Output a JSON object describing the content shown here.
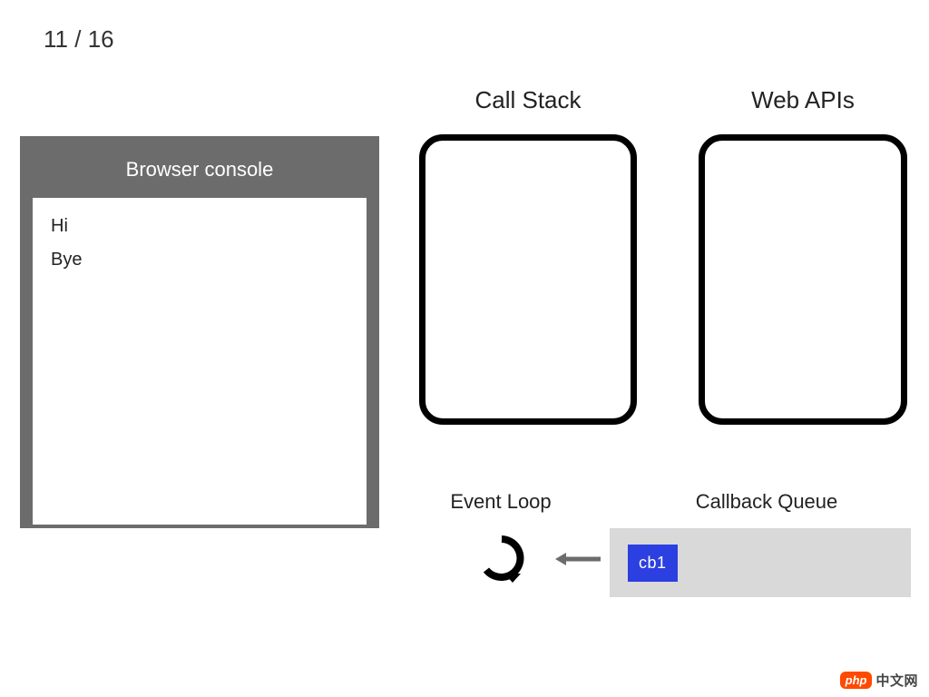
{
  "page": {
    "current": 11,
    "total": 16
  },
  "console": {
    "title": "Browser console",
    "lines": [
      "Hi",
      "Bye"
    ]
  },
  "labels": {
    "call_stack": "Call Stack",
    "web_apis": "Web APIs",
    "event_loop": "Event Loop",
    "callback_queue": "Callback Queue"
  },
  "call_stack": {
    "items": []
  },
  "web_apis": {
    "items": []
  },
  "callback_queue": {
    "items": [
      "cb1"
    ]
  },
  "watermark": {
    "badge": "php",
    "text": "中文网"
  }
}
